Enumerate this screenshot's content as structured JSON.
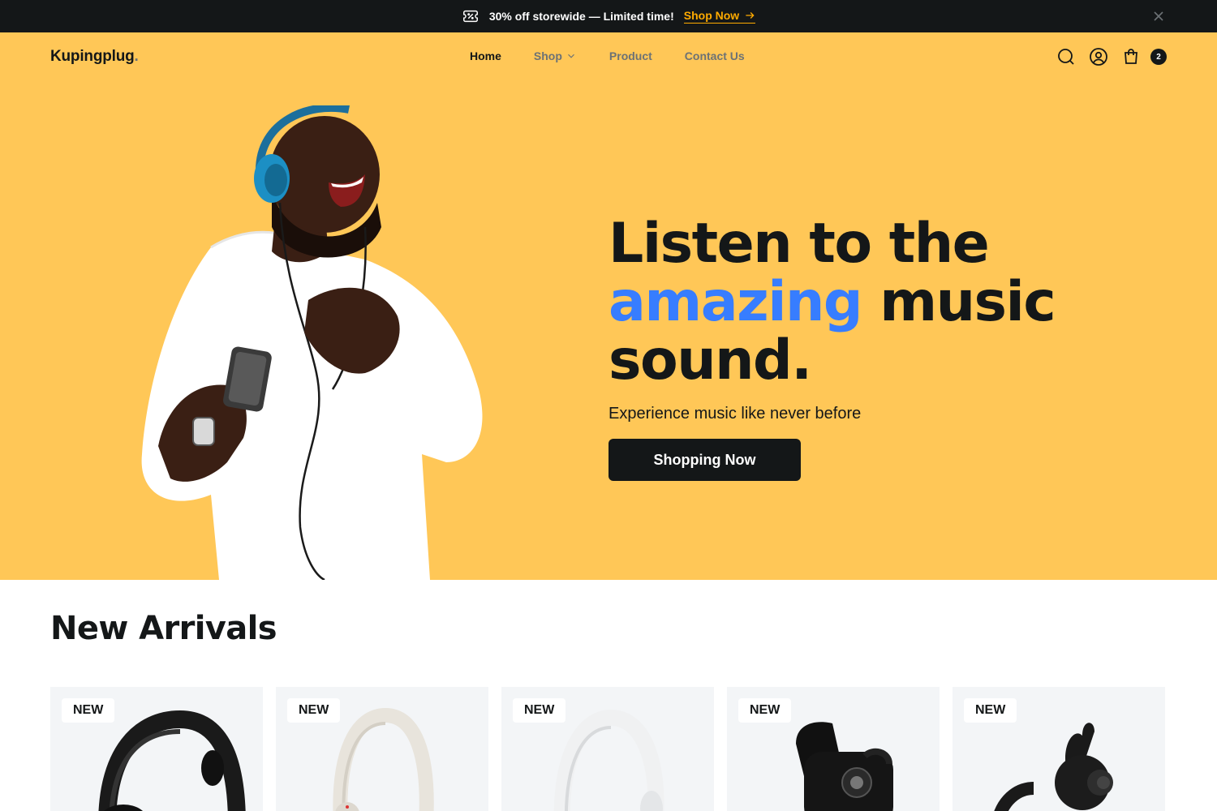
{
  "promo": {
    "text": "30% off storewide — Limited time!",
    "link_label": "Shop Now",
    "icon": "ticket-percent-icon"
  },
  "header": {
    "logo": "Kupingplug",
    "logo_dot": ".",
    "nav": [
      {
        "label": "Home",
        "active": true
      },
      {
        "label": "Shop",
        "has_dropdown": true
      },
      {
        "label": "Product"
      },
      {
        "label": "Contact Us"
      }
    ],
    "icons": [
      "search-icon",
      "user-icon",
      "shopping-bag-icon"
    ],
    "cart_count": "2"
  },
  "hero": {
    "title_line1": "Listen to the",
    "title_accent": "amazing",
    "title_rest": " music",
    "title_line3": "sound.",
    "subtitle": "Experience music like never before",
    "button_label": "Shopping Now"
  },
  "arrivals": {
    "title": "New Arrivals",
    "products": [
      {
        "badge": "NEW",
        "kind": "black-headphones"
      },
      {
        "badge": "NEW",
        "kind": "cream-headphones"
      },
      {
        "badge": "NEW",
        "kind": "white-headphones"
      },
      {
        "badge": "NEW",
        "kind": "black-earbuds-case"
      },
      {
        "badge": "NEW",
        "kind": "black-earbuds"
      }
    ]
  },
  "colors": {
    "promo_bg": "#141718",
    "hero_bg": "#ffc757",
    "accent_blue": "#377dff",
    "promo_link": "#ffab00",
    "card_bg": "#f3f5f7"
  }
}
